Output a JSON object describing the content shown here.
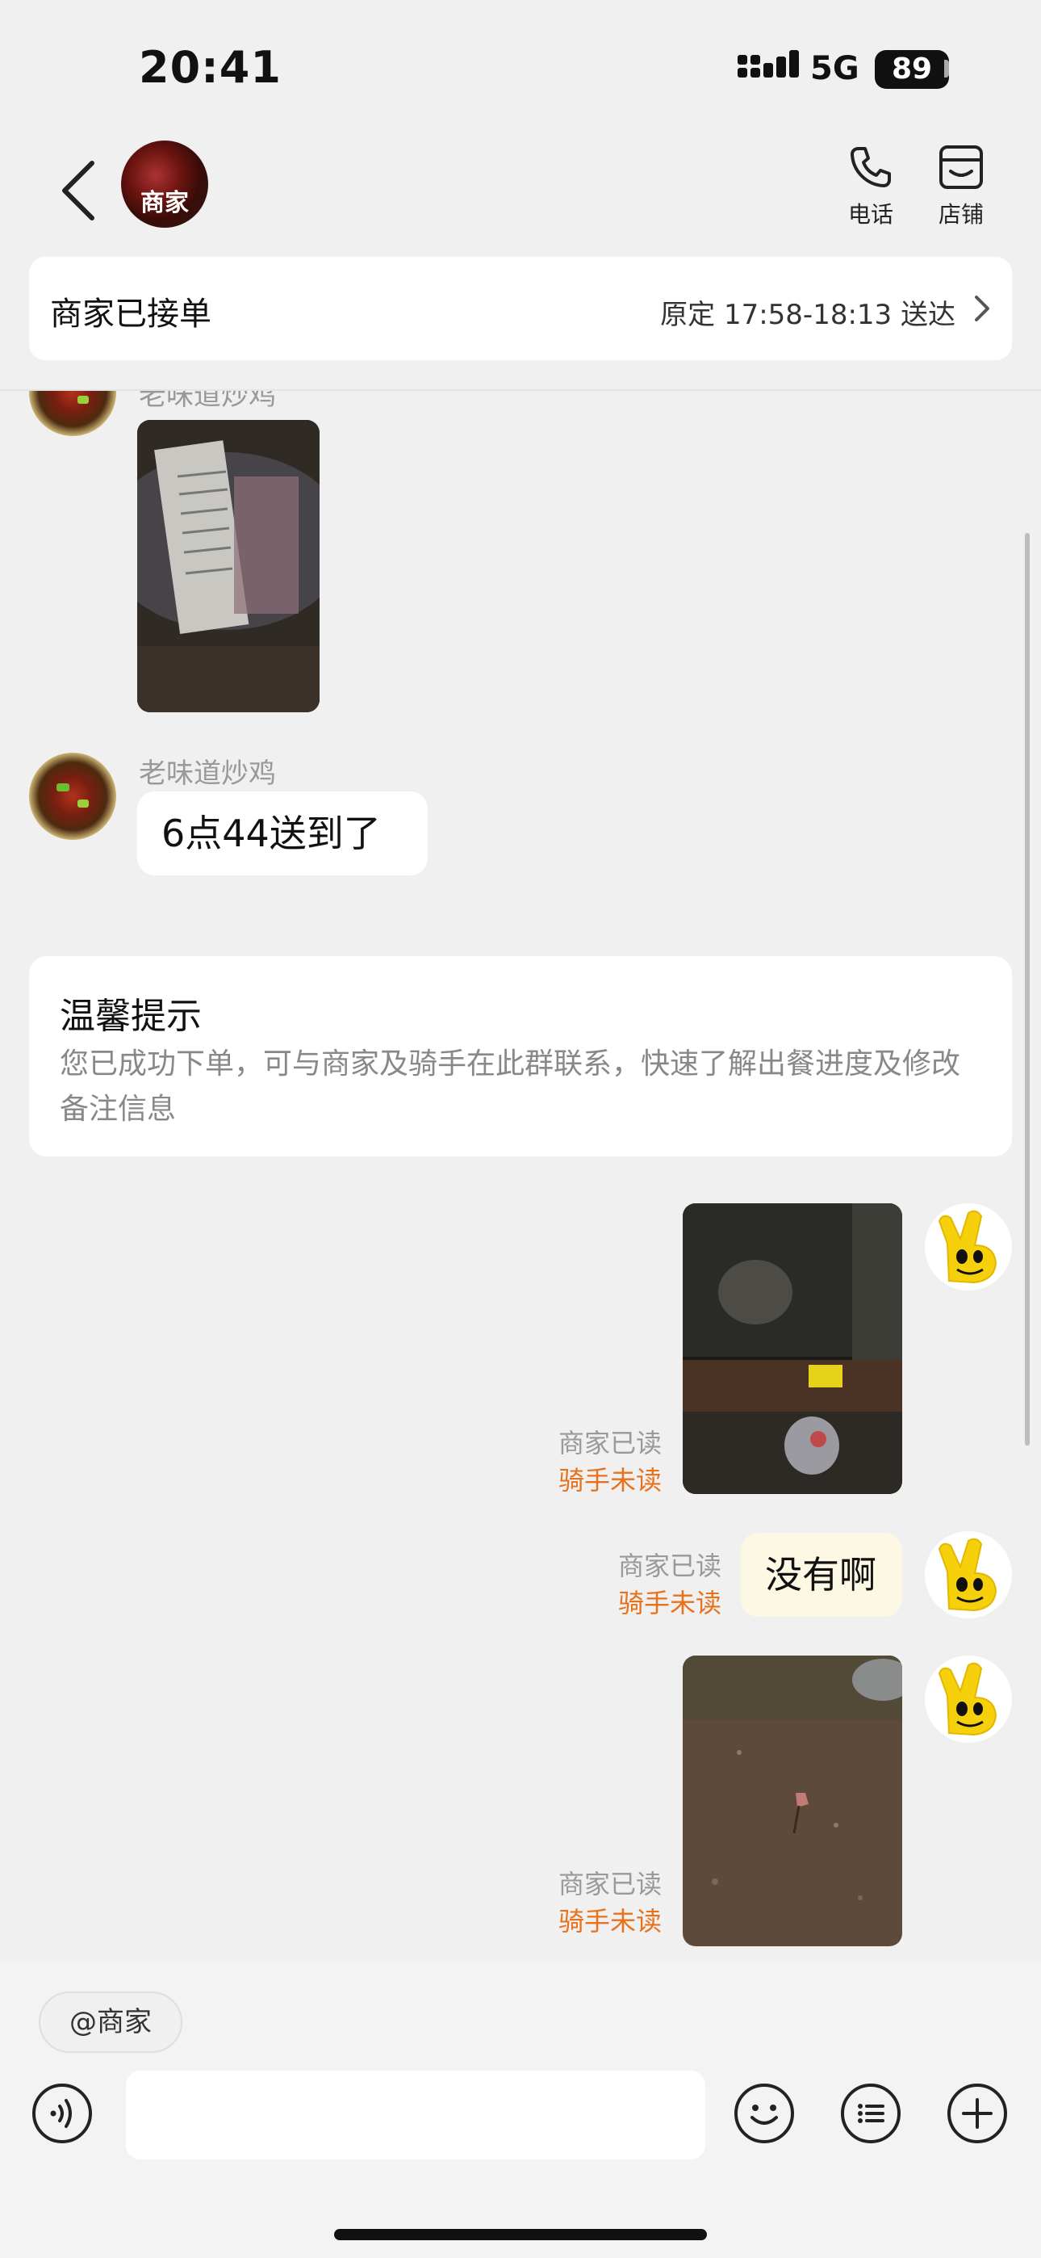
{
  "status_bar": {
    "time": "20:41",
    "network": "5G",
    "battery": "89"
  },
  "header": {
    "shop_avatar_label": "商家",
    "phone_label": "电话",
    "store_label": "店铺"
  },
  "order_status": {
    "title": "商家已接单",
    "eta": "原定 17:58-18:13 送达"
  },
  "messages": {
    "m1_sender": "老味道炒鸡",
    "m2_sender": "老味道炒鸡",
    "m2_text": "6点44送到了",
    "tip_title": "温馨提示",
    "tip_body": "您已成功下单，可与商家及骑手在此群联系，快速了解出餐进度及修改备注信息",
    "m3_read": "商家已读",
    "m3_unread": "骑手未读",
    "m4_text": "没有啊",
    "m4_read": "商家已读",
    "m4_unread": "骑手未读",
    "m5_read": "商家已读",
    "m5_unread": "骑手未读"
  },
  "input": {
    "mention_chip": "@商家",
    "placeholder": ""
  },
  "icons": {
    "back": "chevron-left-icon",
    "phone": "phone-icon",
    "store": "store-icon",
    "voice": "voice-icon",
    "emoji": "emoji-icon",
    "quick_reply": "list-icon",
    "more": "plus-icon"
  },
  "colors": {
    "unread_orange": "#e8721c",
    "outgoing_bubble": "#fdf8e4"
  }
}
